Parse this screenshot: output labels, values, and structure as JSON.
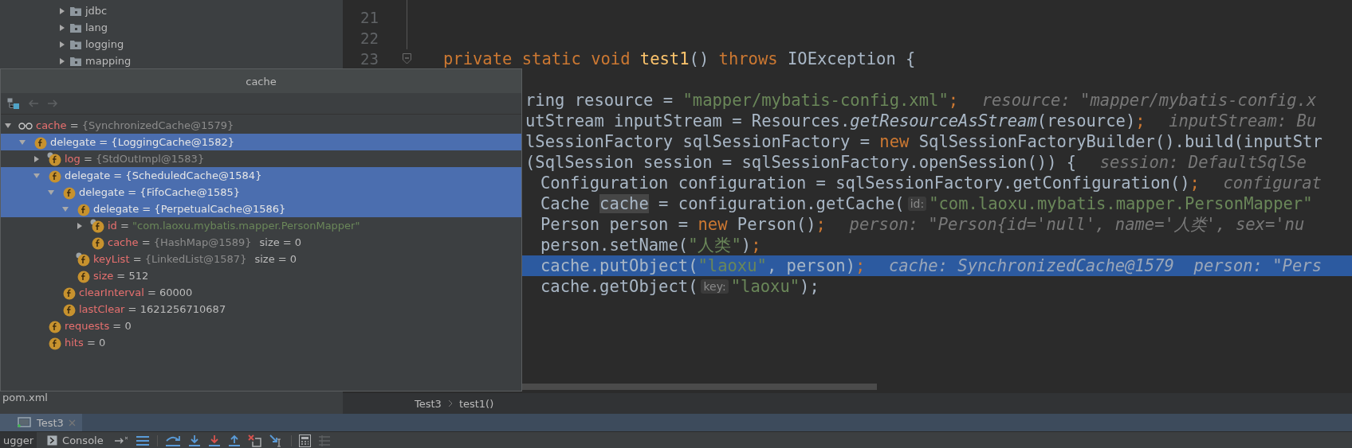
{
  "project_tree": {
    "items": [
      {
        "label": "jdbc",
        "expanded": false
      },
      {
        "label": "lang",
        "expanded": false
      },
      {
        "label": "logging",
        "expanded": false
      },
      {
        "label": "mapping",
        "expanded": false
      }
    ],
    "files": [
      {
        "label": "pom.xml"
      }
    ]
  },
  "editor": {
    "lines": [
      {
        "number": "21",
        "current": false
      },
      {
        "number": "22",
        "current": false
      },
      {
        "number": "23",
        "current": false,
        "foldable": true,
        "segments": [
          {
            "kind": "keyword",
            "text": "private static void "
          },
          {
            "kind": "method",
            "text": "test1"
          },
          {
            "kind": "plain",
            "text": "() "
          },
          {
            "kind": "keyword",
            "text": "throws "
          },
          {
            "kind": "plain",
            "text": "IOException {"
          }
        ],
        "children": [
          {
            "current": false,
            "segments": [
              {
                "kind": "plain",
                "text": "ring resource = "
              },
              {
                "kind": "string",
                "text": "\"mapper/mybatis-config.xml\""
              },
              {
                "kind": "keyword",
                "text": ";"
              },
              {
                "kind": "hint",
                "text": "resource: \"mapper/mybatis-config.x"
              }
            ]
          },
          {
            "current": false,
            "segments": [
              {
                "kind": "plain",
                "text": "utStream inputStream = Resources."
              },
              {
                "kind": "italic",
                "text": "getResourceAsStream"
              },
              {
                "kind": "plain",
                "text": "(resource)"
              },
              {
                "kind": "keyword",
                "text": ";"
              },
              {
                "kind": "hint",
                "text": "inputStream: Bu"
              }
            ]
          },
          {
            "current": false,
            "segments": [
              {
                "kind": "plain",
                "text": "lSessionFactory sqlSessionFactory = "
              },
              {
                "kind": "keyword",
                "text": "new "
              },
              {
                "kind": "plain",
                "text": "SqlSessionFactoryBuilder().build(inputStr"
              }
            ]
          },
          {
            "current": false,
            "segments": [
              {
                "kind": "plain",
                "text": "(SqlSession session = sqlSessionFactory.openSession()) {"
              },
              {
                "kind": "hint",
                "text": "session: DefaultSqlSe"
              }
            ],
            "children": [
              {
                "current": false,
                "segments": [
                  {
                    "kind": "plain",
                    "text": "Configuration configuration = sqlSessionFactory.getConfiguration()"
                  },
                  {
                    "kind": "keyword",
                    "text": ";"
                  },
                  {
                    "kind": "hint",
                    "text": "configurat"
                  }
                ]
              },
              {
                "current": false,
                "segments": [
                  {
                    "kind": "plain",
                    "text": "Cache "
                  },
                  {
                    "kind": "ref",
                    "text": "cache"
                  },
                  {
                    "kind": "plain",
                    "text": " = configuration.getCache("
                  },
                  {
                    "kind": "param",
                    "text": "id:"
                  },
                  {
                    "kind": "string",
                    "text": "\"com.laoxu.mybatis.mapper.PersonMapper\""
                  }
                ]
              },
              {
                "current": false,
                "segments": [
                  {
                    "kind": "plain",
                    "text": "Person person = "
                  },
                  {
                    "kind": "keyword",
                    "text": "new "
                  },
                  {
                    "kind": "plain",
                    "text": "Person()"
                  },
                  {
                    "kind": "keyword",
                    "text": ";"
                  },
                  {
                    "kind": "hint",
                    "text": "person: \"Person{id='null', name='人类', sex='nu"
                  }
                ]
              },
              {
                "current": false,
                "segments": [
                  {
                    "kind": "plain",
                    "text": "person.setName("
                  },
                  {
                    "kind": "string",
                    "text": "\"人类\""
                  },
                  {
                    "kind": "plain",
                    "text": ")"
                  },
                  {
                    "kind": "keyword",
                    "text": ";"
                  }
                ]
              },
              {
                "current": true,
                "segments": [
                  {
                    "kind": "plain",
                    "text": "cache.putObject("
                  },
                  {
                    "kind": "string",
                    "text": "\"laoxu\""
                  },
                  {
                    "kind": "plain",
                    "text": ", person)"
                  },
                  {
                    "kind": "keyword",
                    "text": ";"
                  },
                  {
                    "kind": "hint",
                    "text": "cache: SynchronizedCache@1579  person: \"Pers"
                  }
                ]
              },
              {
                "current": false,
                "segments": [
                  {
                    "kind": "plain",
                    "text": "cache.getObject("
                  },
                  {
                    "kind": "param",
                    "text": "key:"
                  },
                  {
                    "kind": "string",
                    "text": "\"laoxu\""
                  },
                  {
                    "kind": "plain",
                    "text": ");"
                  }
                ]
              }
            ]
          }
        ]
      }
    ]
  },
  "breadcrumb": [
    "Test3",
    "test1()"
  ],
  "popup": {
    "title": "cache",
    "tree": [
      {
        "kind": "watch",
        "name": "cache",
        "value": {
          "kind": "object",
          "text": "= {SynchronizedCache@1579}"
        },
        "selected": false,
        "expanded": true,
        "children": [
          {
            "kind": "field",
            "final": false,
            "name": "delegate",
            "value": {
              "kind": "object",
              "text": "= {LoggingCache@1582}"
            },
            "selected": true,
            "expanded": true,
            "children": [
              {
                "kind": "field",
                "final": true,
                "name": "log",
                "value": {
                  "kind": "object",
                  "text": "= {StdOutImpl@1583}"
                },
                "selected": false,
                "expanded": false
              },
              {
                "kind": "field",
                "final": false,
                "name": "delegate",
                "value": {
                  "kind": "object",
                  "text": "= {ScheduledCache@1584}"
                },
                "selected": true,
                "expanded": true,
                "children": [
                  {
                    "kind": "field",
                    "final": false,
                    "name": "delegate",
                    "value": {
                      "kind": "object",
                      "text": "= {FifoCache@1585}"
                    },
                    "selected": true,
                    "expanded": true,
                    "children": [
                      {
                        "kind": "field",
                        "final": false,
                        "name": "delegate",
                        "value": {
                          "kind": "object",
                          "text": "= {PerpetualCache@1586}"
                        },
                        "selected": true,
                        "expanded": true,
                        "children": [
                          {
                            "kind": "field",
                            "final": true,
                            "name": "id",
                            "value": {
                              "kind": "string",
                              "text": "= \"com.laoxu.mybatis.mapper.PersonMapper\""
                            },
                            "selected": false,
                            "expanded": false
                          },
                          {
                            "kind": "field",
                            "final": false,
                            "name": "cache",
                            "value": {
                              "kind": "object",
                              "text": "= {HashMap@1589}"
                            },
                            "extra": "size = 0",
                            "selected": false
                          }
                        ]
                      },
                      {
                        "kind": "field",
                        "final": true,
                        "name": "keyList",
                        "value": {
                          "kind": "object",
                          "text": "= {LinkedList@1587}"
                        },
                        "extra": "size = 0",
                        "selected": false
                      },
                      {
                        "kind": "field",
                        "final": false,
                        "name": "size",
                        "value": {
                          "kind": "number",
                          "text": "= 512"
                        },
                        "selected": false
                      }
                    ]
                  },
                  {
                    "kind": "field",
                    "final": false,
                    "name": "clearInterval",
                    "value": {
                      "kind": "number",
                      "text": "= 60000"
                    },
                    "selected": false
                  },
                  {
                    "kind": "field",
                    "final": false,
                    "name": "lastClear",
                    "value": {
                      "kind": "number",
                      "text": "= 1621256710687"
                    },
                    "selected": false
                  }
                ]
              },
              {
                "kind": "field",
                "final": false,
                "name": "requests",
                "value": {
                  "kind": "number",
                  "text": "= 0"
                },
                "selected": false
              },
              {
                "kind": "field",
                "final": false,
                "name": "hits",
                "value": {
                  "kind": "number",
                  "text": "= 0"
                },
                "selected": false
              }
            ]
          }
        ]
      }
    ]
  },
  "run_tabs": [
    {
      "label": "Test3",
      "selected": true
    }
  ],
  "bottom_tabs": [
    {
      "label": "ugger",
      "selected": true
    },
    {
      "label": "Console",
      "selected": false
    }
  ]
}
